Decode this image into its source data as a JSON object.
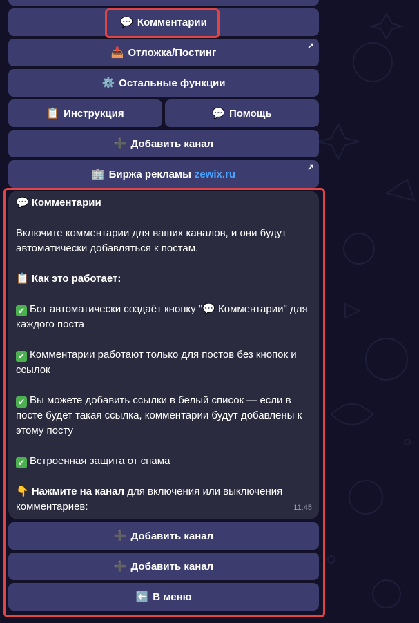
{
  "keyboard_top": {
    "comments": {
      "icon": "💬",
      "label": "Комментарии"
    },
    "postponed": {
      "icon": "📥",
      "label": "Отложка/Постинг",
      "arrow": "↗"
    },
    "other": {
      "icon": "⚙️",
      "label": "Остальные функции"
    },
    "instruction": {
      "icon": "📋",
      "label": "Инструкция"
    },
    "help": {
      "icon": "💬",
      "label": "Помощь"
    },
    "add_channel": {
      "icon": "➕",
      "label": "Добавить канал"
    },
    "ads": {
      "icon": "🏢",
      "label": "Биржа рекламы",
      "link": "zewix.ru",
      "arrow": "↗"
    }
  },
  "message": {
    "title_icon": "💬",
    "title": "Комментарии",
    "intro": "Включите комментарии для ваших каналов, и они будут автоматически добавляться к постам.",
    "how_icon": "📋",
    "how_title": "Как это работает:",
    "check_icon": "✔",
    "points": [
      "Бот автоматически создаёт кнопку \"💬 Комментарии\" для каждого поста",
      "Комментарии работают только для постов без кнопок и ссылок",
      "Вы можете добавить ссылки в белый список — если в посте будет такая ссылка, комментарии будут добавлены к этому посту",
      "Встроенная защита от спама"
    ],
    "cta_icon": "👇",
    "cta_bold": "Нажмите на канал",
    "cta_rest": "для включения или выключения комментариев:",
    "time": "11:45"
  },
  "keyboard_bottom": {
    "add_channel_1": {
      "icon": "➕",
      "label": "Добавить канал"
    },
    "add_channel_2": {
      "icon": "➕",
      "label": "Добавить канал"
    },
    "menu": {
      "icon": "⬅️",
      "label": "В меню"
    }
  }
}
